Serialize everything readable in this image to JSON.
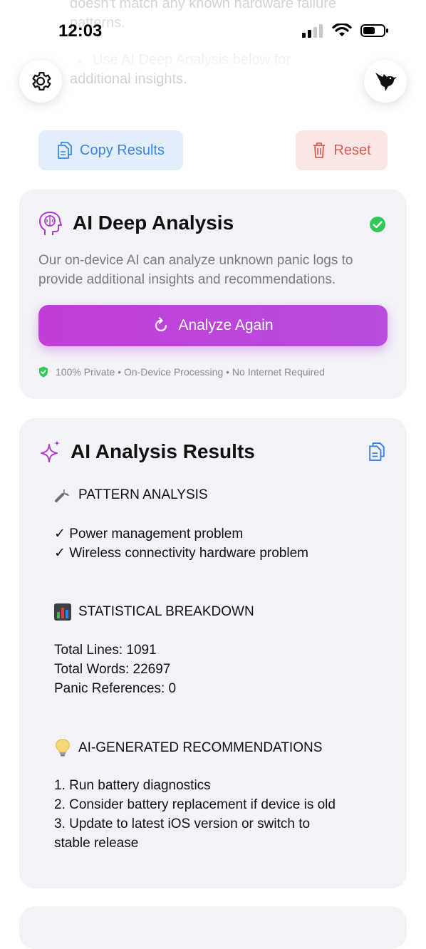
{
  "background_text": {
    "line1": "doesn't match any known hardware failure",
    "line2": "patterns.",
    "line3": "Use AI Deep Analysis below for",
    "line4": "additional insights."
  },
  "status_bar": {
    "time": "12:03"
  },
  "actions": {
    "copy_label": "Copy Results",
    "reset_label": "Reset"
  },
  "deep_analysis": {
    "title": "AI Deep Analysis",
    "description_line1": "Our on-device AI can analyze unknown panic logs to",
    "description_line2": "provide additional insights and recommendations.",
    "button_label": "Analyze Again",
    "privacy": "100% Private • On-Device Processing • No Internet Required"
  },
  "results": {
    "title": "AI Analysis Results",
    "pattern": {
      "heading": "PATTERN ANALYSIS",
      "items": [
        "✓ Power management problem",
        "✓ Wireless connectivity hardware problem"
      ]
    },
    "stats": {
      "heading": "STATISTICAL BREAKDOWN",
      "items": [
        "Total Lines: 1091",
        "Total Words: 22697",
        "Panic References: 0"
      ]
    },
    "recommendations": {
      "heading": "AI-GENERATED RECOMMENDATIONS",
      "items": [
        "1. Run battery diagnostics",
        "2. Consider battery replacement if device is old",
        "3. Update to latest iOS version or switch to",
        "stable release"
      ]
    }
  },
  "colors": {
    "accent_blue": "#3a86e0",
    "danger_red": "#e05a55",
    "purple": "#c13ed8",
    "success": "#34c759"
  }
}
